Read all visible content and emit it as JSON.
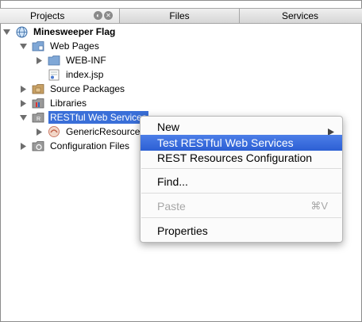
{
  "tabs": [
    {
      "label": "Projects",
      "active": true
    },
    {
      "label": "Files",
      "active": false
    },
    {
      "label": "Services",
      "active": false
    }
  ],
  "tree": {
    "project": "Minesweeper Flag",
    "web_pages": "Web Pages",
    "web_inf": "WEB-INF",
    "index_jsp": "index.jsp",
    "source_packages": "Source Packages",
    "libraries": "Libraries",
    "restful": "RESTful Web Services",
    "generic_resource": "GenericResource",
    "configuration_files": "Configuration Files"
  },
  "context_menu": {
    "new": "New",
    "test_restful": "Test RESTful Web Services",
    "rest_config": "REST Resources Configuration",
    "find": "Find...",
    "paste": "Paste",
    "paste_shortcut": "⌘V",
    "properties": "Properties"
  },
  "icons": {
    "project": "globe-project-icon",
    "folder": "folder-icon",
    "jsp_file": "jsp-file-icon",
    "package_folder": "package-folder-icon",
    "rest_service": "rest-service-icon"
  },
  "colors": {
    "selection": "#3a6fd8",
    "menu_highlight": "#2c5fd4",
    "disabled_text": "#a7a7a7"
  }
}
